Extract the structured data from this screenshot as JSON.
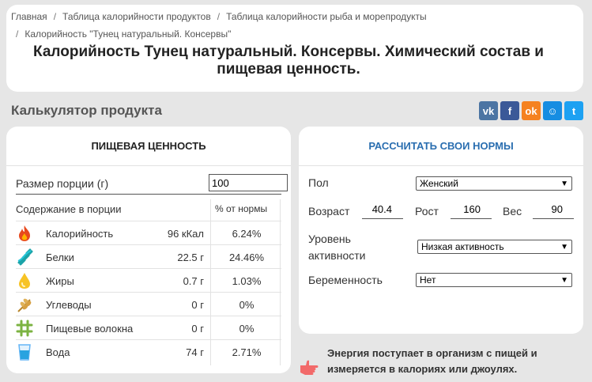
{
  "breadcrumb": {
    "items": [
      "Главная",
      "Таблица калорийности продуктов",
      "Таблица калорийности рыба и морепродукты",
      "Калорийность \"Тунец натуральный. Консервы\""
    ]
  },
  "page": {
    "title": "Калорийность Тунец натуральный. Консервы. Химический состав и пищевая ценность."
  },
  "calculator": {
    "title": "Калькулятор продукта"
  },
  "social": {
    "icons": [
      "vk-icon",
      "facebook-icon",
      "odnoklassniki-icon",
      "moimir-icon",
      "twitter-icon"
    ],
    "labels": [
      "vk",
      "f",
      "ok",
      "☺",
      "t"
    ],
    "colors": [
      "#4c75a3",
      "#3b5998",
      "#f58220",
      "#168de2",
      "#1da1f2"
    ]
  },
  "nutrition": {
    "heading": "ПИЩЕВАЯ ЦЕННОСТЬ",
    "portion_label": "Размер порции (г)",
    "portion_value": "100",
    "col_content": "Содержание в порции",
    "col_percent": "% от нормы",
    "rows": [
      {
        "name": "Калорийность",
        "value": "96 кКал",
        "percent": "6.24%",
        "icon": "fire-icon"
      },
      {
        "name": "Белки",
        "value": "22.5 г",
        "percent": "24.46%",
        "icon": "protein-icon"
      },
      {
        "name": "Жиры",
        "value": "0.7 г",
        "percent": "1.03%",
        "icon": "fat-drop-icon"
      },
      {
        "name": "Углеводы",
        "value": "0 г",
        "percent": "0%",
        "icon": "grain-icon"
      },
      {
        "name": "Пищевые волокна",
        "value": "0 г",
        "percent": "0%",
        "icon": "fiber-icon"
      },
      {
        "name": "Вода",
        "value": "74 г",
        "percent": "2.71%",
        "icon": "water-glass-icon"
      }
    ]
  },
  "norms": {
    "heading": "РАССЧИТАТЬ СВОИ НОРМЫ",
    "gender_label": "Пол",
    "gender_value": "Женский",
    "age_label": "Возраст",
    "age_value": "40.4",
    "height_label": "Рост",
    "height_value": "160",
    "weight_label": "Вес",
    "weight_value": "90",
    "activity_label": "Уровень активности",
    "activity_value": "Низкая активность",
    "pregnancy_label": "Беременность",
    "pregnancy_value": "Нет"
  },
  "energy": {
    "text": "Энергия поступает в организм с пищей и измеряется в калориях или джоулях."
  },
  "colors": {
    "accent_blue": "#2a6eb0",
    "card_bg": "#ffffff",
    "page_bg": "#e6e6e6"
  }
}
